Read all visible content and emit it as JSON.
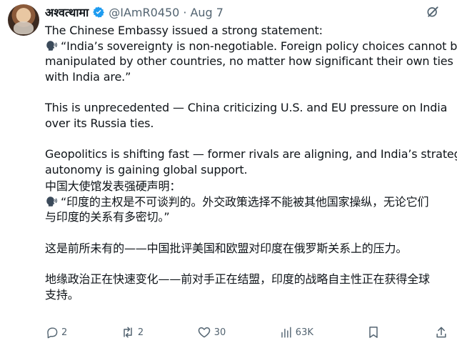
{
  "tweet": {
    "author": {
      "display_name": "अश्वत्थामा",
      "handle": "@IAmR0450",
      "separator": "·",
      "date": "Aug 7"
    },
    "paragraphs": [
      {
        "lines": [
          "The Chinese Embassy issued a strong statement:",
          "“India’s sovereignty is non-negotiable. Foreign policy choices cannot be",
          "manipulated by other countries, no matter how significant their own ties",
          "with India are.”"
        ]
      },
      {
        "lines": [
          "This is unprecedented — China criticizing U.S. and EU pressure on India",
          "over its Russia ties."
        ]
      },
      {
        "lines": [
          "Geopolitics is shifting fast — former rivals are aligning, and India’s strategic",
          "autonomy is gaining global support."
        ]
      },
      {
        "lines": [
          "中国大使馆发表强硬声明：",
          "“印度的主权是不可谈判的。外交政策选择不能被其他国家操纵，无论它们",
          "与印度的关系有多密切。”"
        ]
      },
      {
        "lines": [
          "这是前所未有的——中国批评美国和欧盟对印度在俄罗斯关系上的压力。"
        ]
      },
      {
        "lines": [
          "地缘政治正在快速变化——前对手正在结盟，印度的战略自主性正在获得全球",
          "支持。"
        ]
      }
    ],
    "actions": {
      "replies": "2",
      "reposts": "2",
      "likes": "30",
      "views": "63K"
    },
    "icons": {
      "verified": "verified-badge-icon",
      "grok": "grok-icon",
      "speech": "speaking-head-icon",
      "reply": "reply-icon",
      "repost": "repost-icon",
      "like": "like-icon",
      "views": "views-icon",
      "bookmark": "bookmark-icon",
      "share": "share-icon"
    },
    "colors": {
      "text": "#0f1419",
      "secondary": "#536471",
      "verified": "#1d9bf0"
    }
  }
}
